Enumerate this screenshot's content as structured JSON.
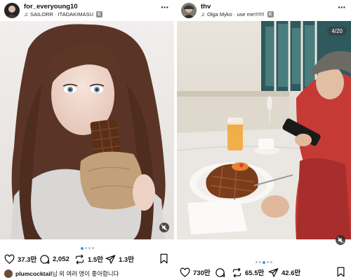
{
  "left_post": {
    "username": "for_everyoung10",
    "music": "SAILORR · ITADAKIMASU",
    "badge": "E",
    "likes": "37.3만",
    "comments": "2,052",
    "reposts": "1.5만",
    "shares": "1.3만",
    "comment": {
      "user": "plumcocktail",
      "text": "님 외 여러 명이 좋아합니다"
    }
  },
  "right_post": {
    "username": "thv",
    "music": "Olga Myko · use me!!!!!!!",
    "badge": "E",
    "page_counter": "4/20",
    "likes": "730만",
    "comments": "",
    "reposts": "65.5만",
    "shares": "42.6만"
  },
  "icons": {
    "music": "music-note-icon",
    "more": "more-icon",
    "like": "heart-icon",
    "comment": "comment-icon",
    "repost": "repost-icon",
    "share": "share-icon",
    "save": "bookmark-icon",
    "mute": "mute-icon"
  },
  "colors": {
    "accent": "#3897f0",
    "text": "#111111",
    "badge": "#8e8e8e"
  }
}
